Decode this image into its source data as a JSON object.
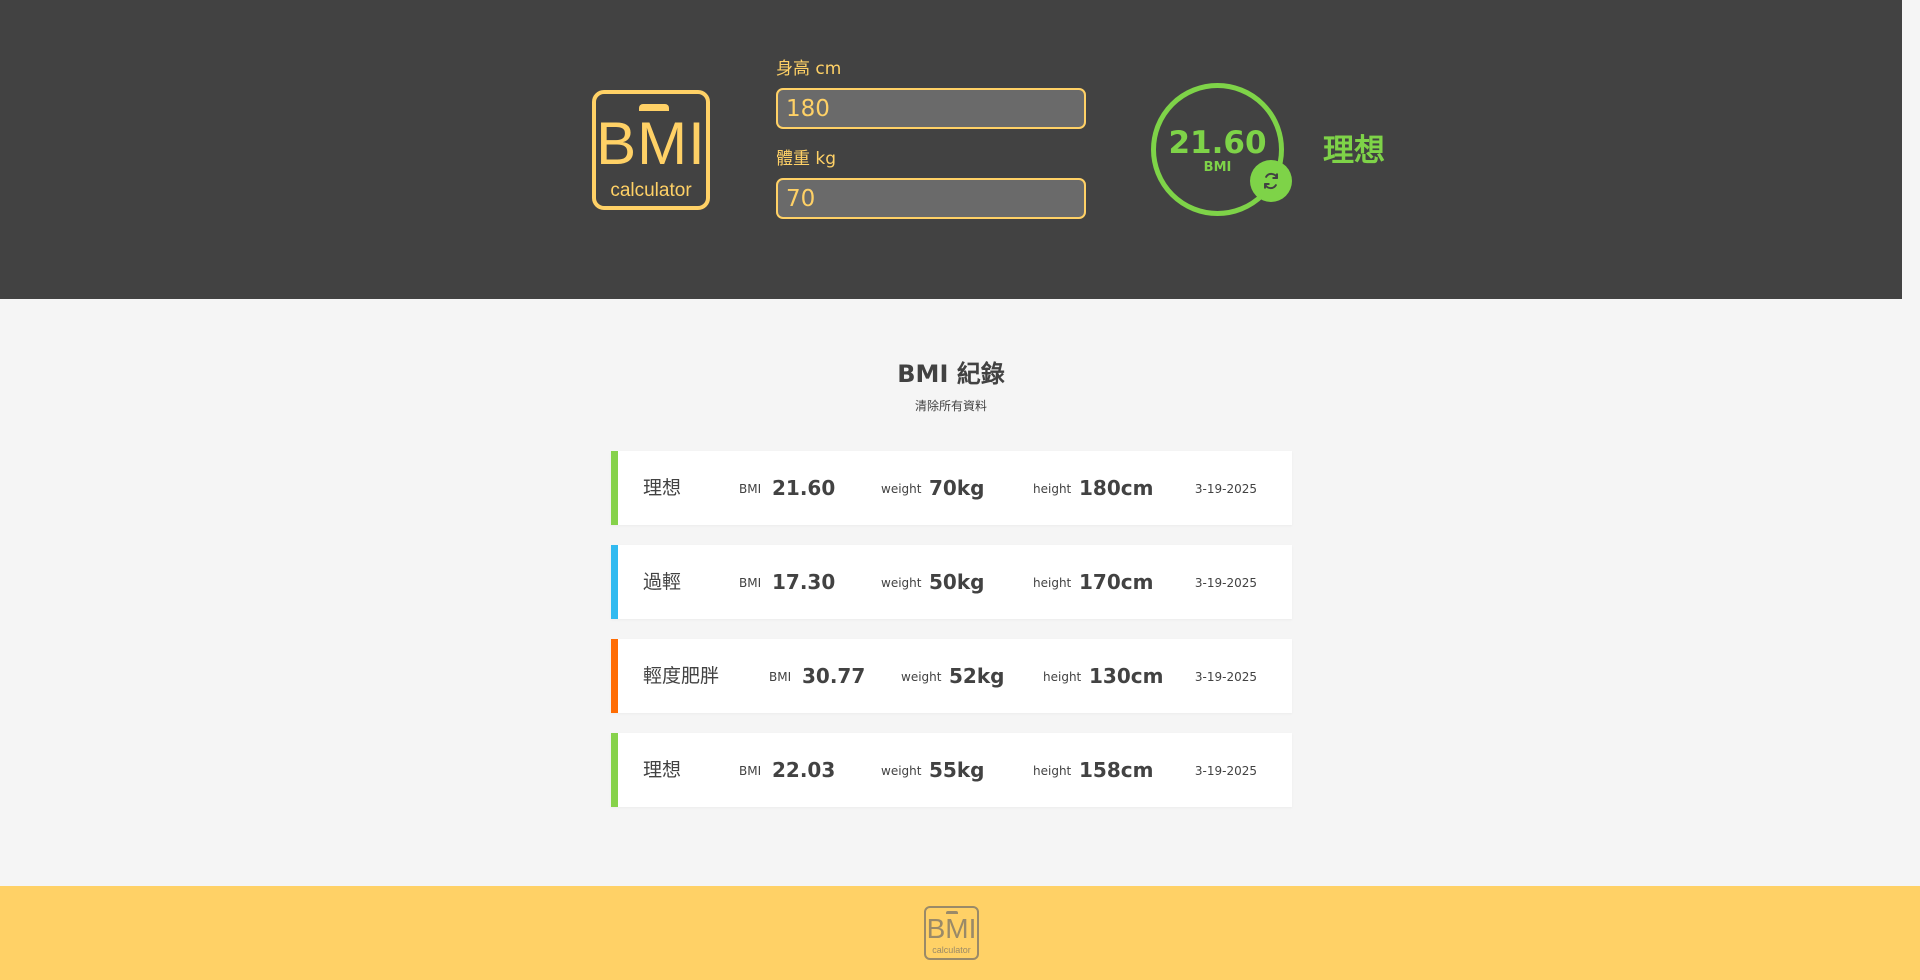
{
  "header": {
    "logo": {
      "big": "BMI",
      "small": "calculator"
    },
    "height": {
      "label": "身高 cm",
      "value": "180"
    },
    "weight": {
      "label": "體重 kg",
      "value": "70"
    },
    "result": {
      "value": "21.60",
      "unit": "BMI",
      "status": "理想",
      "color": "#7ed348",
      "reset_icon": "refresh-icon"
    }
  },
  "records": {
    "title": "BMI 紀錄",
    "clear_label": "清除所有資料",
    "labels": {
      "bmi": "BMI",
      "weight": "weight",
      "height": "height"
    },
    "items": [
      {
        "status": "理想",
        "bmi": "21.60",
        "weight": "70kg",
        "height": "180cm",
        "date": "3-19-2025",
        "color": "#86d24a"
      },
      {
        "status": "過輕",
        "bmi": "17.30",
        "weight": "50kg",
        "height": "170cm",
        "date": "3-19-2025",
        "color": "#31baf0"
      },
      {
        "status": "輕度肥胖",
        "bmi": "30.77",
        "weight": "52kg",
        "height": "130cm",
        "date": "3-19-2025",
        "color": "#ff6c03"
      },
      {
        "status": "理想",
        "bmi": "22.03",
        "weight": "55kg",
        "height": "158cm",
        "date": "3-19-2025",
        "color": "#86d24a"
      }
    ]
  },
  "footer": {
    "logo": {
      "big": "BMI",
      "small": "calculator"
    }
  },
  "colors": {
    "header_bg": "#424242",
    "accent": "#ffd166",
    "page_bg": "#f5f5f5"
  }
}
